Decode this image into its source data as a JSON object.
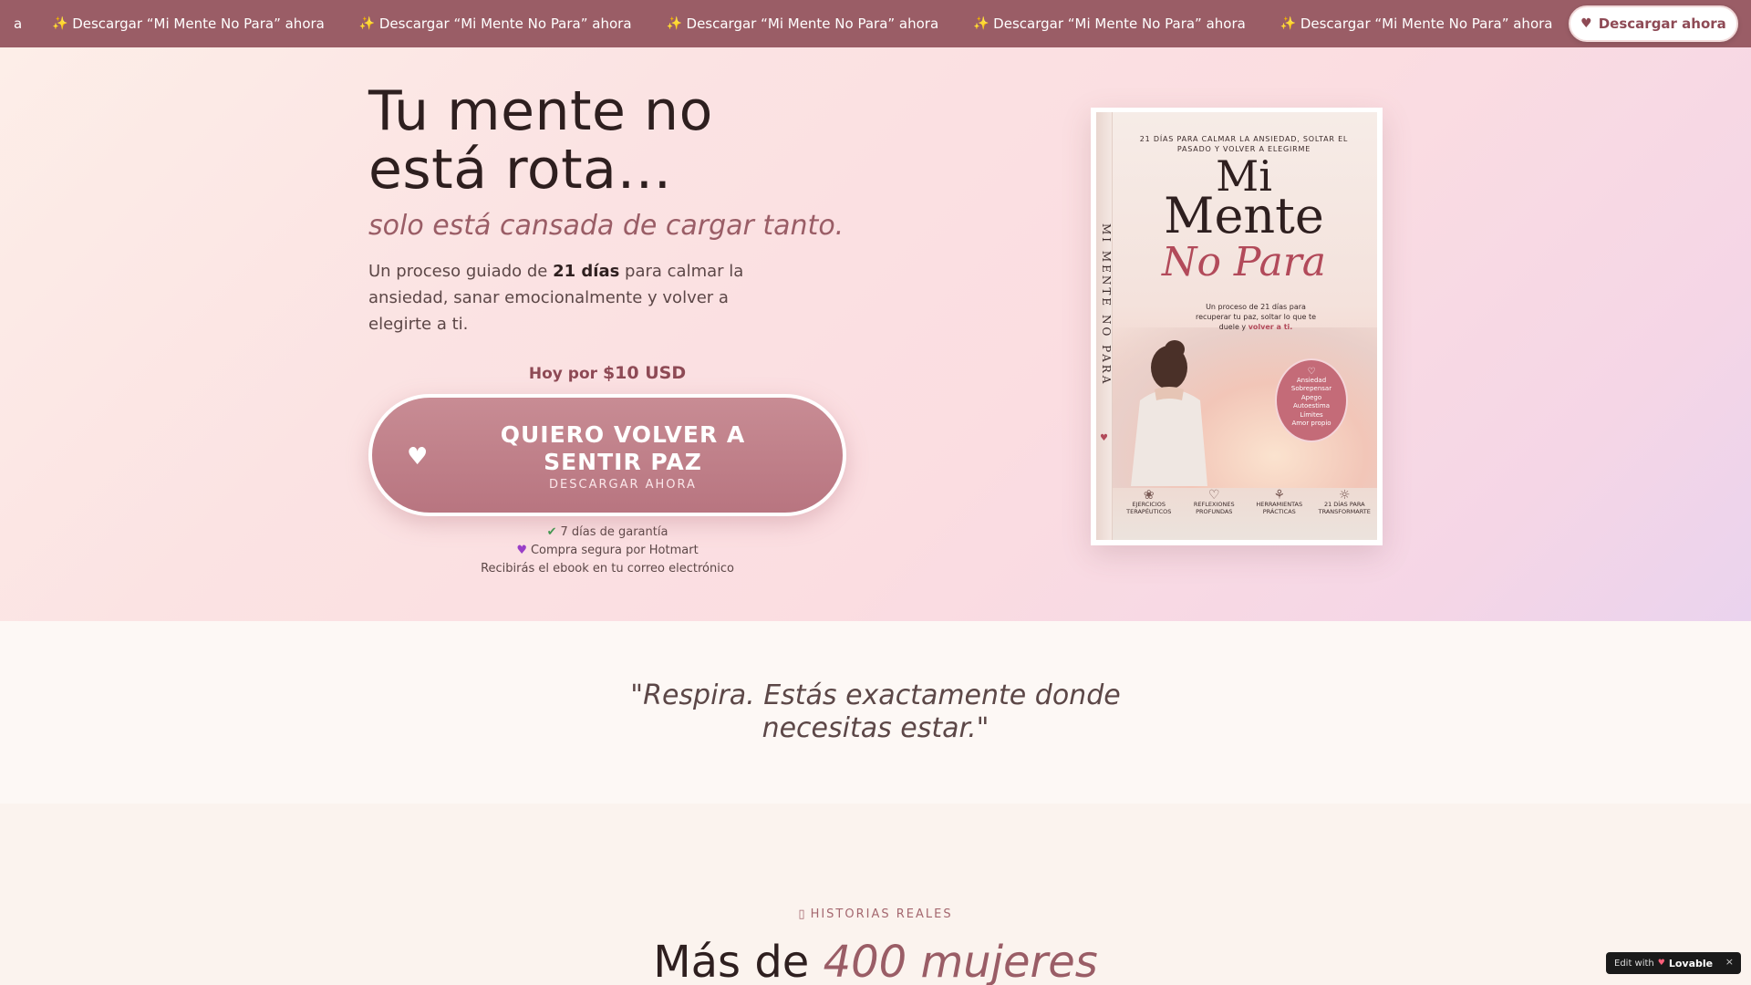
{
  "topbar": {
    "lead_fragment": "a",
    "items": [
      "Descargar “Mi Mente No Para” ahora",
      "Descargar “Mi Mente No Para” ahora",
      "Descargar “Mi Mente No Para” ahora",
      "Descargar “Mi Mente No Para” ahora",
      "Descargar “Mi Mente No Para” ahora"
    ],
    "cta_label": "Descargar ahora",
    "icons": {
      "item": "sparkles-icon",
      "cta": "heart-icon"
    }
  },
  "hero": {
    "title_line1": "Tu mente no",
    "title_line2": "está rota…",
    "subtitle": "solo está cansada de cargar tanto.",
    "desc_before": "Un proceso guiado de ",
    "desc_bold": "21 días",
    "desc_after": " para calmar la ansiedad, sanar emocionalmente y volver a elegirte a ti.",
    "price_prefix": "Hoy por ",
    "price_amount": "$10 USD",
    "cta_main": "QUIERO VOLVER A SENTIR PAZ",
    "cta_sub": "DESCARGAR AHORA",
    "guarantee": "7 días de garantía",
    "secure": "Compra segura por Hotmart",
    "delivery": "Recibirás el ebook en tu correo electrónico"
  },
  "book": {
    "top_text": "21 DÍAS PARA CALMAR LA ANSIEDAD, SOLTAR EL PASADO Y VOLVER A ELEGIRME",
    "title_mi": "Mi",
    "title_mente": "Mente",
    "title_nopara": "No Para",
    "desc_before": "Un proceso de 21 días para recuperar tu paz, soltar lo que te duele y ",
    "desc_bold": "volver a ti.",
    "spine": "MI MENTE NO PARA",
    "badge": [
      "Ansiedad",
      "Sobrepensar",
      "Apego",
      "Autoestima",
      "Límites",
      "Amor propio"
    ],
    "features": [
      {
        "label": "EJERCICIOS TERAPÉUTICOS",
        "icon": "lotus-icon"
      },
      {
        "label": "REFLEXIONES PROFUNDAS",
        "icon": "heart-outline-icon"
      },
      {
        "label": "HERRAMIENTAS PRÁCTICAS",
        "icon": "sprout-icon"
      },
      {
        "label": "21 DÍAS PARA TRANSFORMARTE",
        "icon": "sunrise-icon"
      }
    ]
  },
  "quote": {
    "text": "\"Respira. Estás exactamente donde necesitas estar.\""
  },
  "stories": {
    "eyebrow": "HISTORIAS REALES",
    "title_plain": "Más de ",
    "title_em": "400 mujeres"
  },
  "lovable": {
    "edit_with": "Edit with",
    "brand": "Lovable",
    "close": "×"
  },
  "colors": {
    "brand_rose": "#9a5d66",
    "cta_pink": "#c88c94",
    "accent_red": "#b24a5a"
  }
}
